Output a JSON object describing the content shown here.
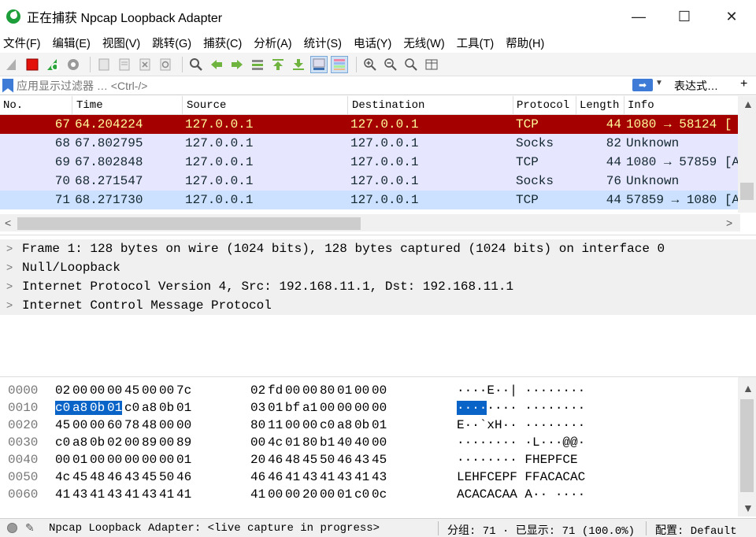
{
  "window": {
    "title": "正在捕获 Npcap Loopback Adapter",
    "minimize": "—",
    "maximize": "☐",
    "close": "✕"
  },
  "menu": [
    "文件(F)",
    "编辑(E)",
    "视图(V)",
    "跳转(G)",
    "捕获(C)",
    "分析(A)",
    "统计(S)",
    "电话(Y)",
    "无线(W)",
    "工具(T)",
    "帮助(H)"
  ],
  "toolbar": {
    "icons": [
      "shark-fin-start-icon",
      "stop-capture-icon",
      "restart-capture-icon",
      "capture-options-icon",
      "open-file-icon",
      "save-file-icon",
      "close-file-icon",
      "reload-file-icon",
      "find-packet-icon",
      "go-back-icon",
      "go-forward-icon",
      "go-to-packet-icon",
      "go-first-icon",
      "go-last-icon",
      "auto-scroll-icon",
      "colorize-icon",
      "zoom-in-icon",
      "zoom-out-icon",
      "zoom-normal-icon",
      "resize-columns-icon"
    ]
  },
  "filter": {
    "placeholder": "应用显示过滤器 … <Ctrl-/>",
    "expression_label": "表达式…",
    "add_label": "+"
  },
  "packet_list": {
    "columns": [
      "No.",
      "Time",
      "Source",
      "Destination",
      "Protocol",
      "Length",
      "Info"
    ],
    "rows": [
      {
        "no": "67",
        "time": "64.204224",
        "source": "127.0.0.1",
        "destination": "127.0.0.1",
        "protocol": "TCP",
        "length": "44",
        "info": "1080 → 58124 [",
        "bg": "#a40000",
        "fg": "#fffc9c"
      },
      {
        "no": "68",
        "time": "67.802795",
        "source": "127.0.0.1",
        "destination": "127.0.0.1",
        "protocol": "Socks",
        "length": "82",
        "info": "Unknown",
        "bg": "#e7e6ff",
        "fg": "#12272e"
      },
      {
        "no": "69",
        "time": "67.802848",
        "source": "127.0.0.1",
        "destination": "127.0.0.1",
        "protocol": "TCP",
        "length": "44",
        "info": "1080 → 57859 [A",
        "bg": "#e7e6ff",
        "fg": "#12272e"
      },
      {
        "no": "70",
        "time": "68.271547",
        "source": "127.0.0.1",
        "destination": "127.0.0.1",
        "protocol": "Socks",
        "length": "76",
        "info": "Unknown",
        "bg": "#e7e6ff",
        "fg": "#12272e"
      },
      {
        "no": "71",
        "time": "68.271730",
        "source": "127.0.0.1",
        "destination": "127.0.0.1",
        "protocol": "TCP",
        "length": "44",
        "info": "57859 → 1080 [A",
        "bg": "#cce0ff",
        "fg": "#12272e"
      }
    ]
  },
  "details": [
    "Frame 1: 128 bytes on wire (1024 bits), 128 bytes captured (1024 bits) on interface 0",
    "Null/Loopback",
    "Internet Protocol Version 4, Src: 192.168.11.1, Dst: 192.168.11.1",
    "Internet Control Message Protocol"
  ],
  "hex": [
    {
      "offset": "0000",
      "bytes": [
        "02",
        "00",
        "00",
        "00",
        "45",
        "00",
        "00",
        "7c",
        "02",
        "fd",
        "00",
        "00",
        "80",
        "01",
        "00",
        "00"
      ],
      "ascii": "····E··| ········"
    },
    {
      "offset": "0010",
      "bytes": [
        "c0",
        "a8",
        "0b",
        "01",
        "c0",
        "a8",
        "0b",
        "01",
        "03",
        "01",
        "bf",
        "a1",
        "00",
        "00",
        "00",
        "00"
      ],
      "ascii": "········ ········",
      "selected_bytes": [
        0,
        1,
        2,
        3
      ],
      "selected_ascii": "····"
    },
    {
      "offset": "0020",
      "bytes": [
        "45",
        "00",
        "00",
        "60",
        "78",
        "48",
        "00",
        "00",
        "80",
        "11",
        "00",
        "00",
        "c0",
        "a8",
        "0b",
        "01"
      ],
      "ascii": "E··`xH·· ········"
    },
    {
      "offset": "0030",
      "bytes": [
        "c0",
        "a8",
        "0b",
        "02",
        "00",
        "89",
        "00",
        "89",
        "00",
        "4c",
        "01",
        "80",
        "b1",
        "40",
        "40",
        "00"
      ],
      "ascii": "········ ·L···@@·"
    },
    {
      "offset": "0040",
      "bytes": [
        "00",
        "01",
        "00",
        "00",
        "00",
        "00",
        "00",
        "01",
        "20",
        "46",
        "48",
        "45",
        "50",
        "46",
        "43",
        "45"
      ],
      "ascii": "········  FHEPFCE"
    },
    {
      "offset": "0050",
      "bytes": [
        "4c",
        "45",
        "48",
        "46",
        "43",
        "45",
        "50",
        "46",
        "46",
        "46",
        "41",
        "43",
        "41",
        "43",
        "41",
        "43"
      ],
      "ascii": "LEHFCEPF FFACACAC"
    },
    {
      "offset": "0060",
      "bytes": [
        "41",
        "43",
        "41",
        "43",
        "41",
        "43",
        "41",
        "41",
        "41",
        "00",
        "00",
        "20",
        "00",
        "01",
        "c0",
        "0c"
      ],
      "ascii": "ACACACAA A·· ····"
    }
  ],
  "status": {
    "capture_text": "Npcap Loopback Adapter: <live capture in progress>",
    "packets_text": "分组: 71 · 已显示: 71 (100.0%)",
    "profile_text": "配置: Default"
  }
}
